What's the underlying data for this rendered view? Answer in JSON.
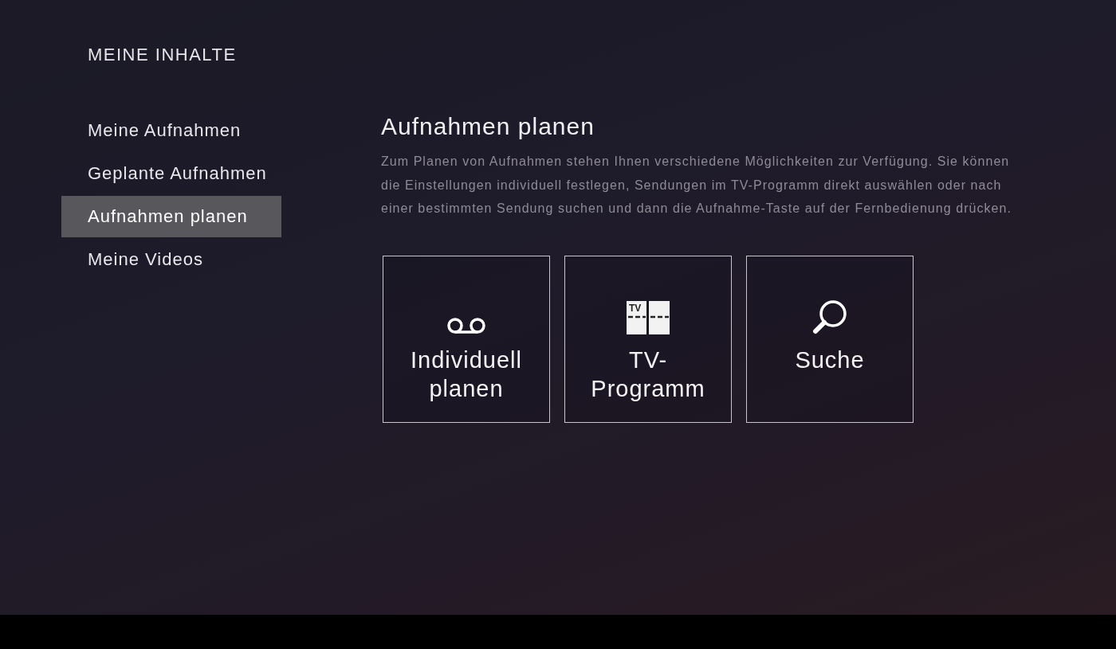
{
  "sidebar": {
    "heading": "MEINE INHALTE",
    "items": [
      {
        "label": "Meine Aufnahmen",
        "selected": false
      },
      {
        "label": "Geplante Aufnahmen",
        "selected": false
      },
      {
        "label": "Aufnahmen planen",
        "selected": true
      },
      {
        "label": "Meine Videos",
        "selected": false
      }
    ]
  },
  "content": {
    "title": "Aufnahmen planen",
    "description": "Zum Planen von Aufnahmen stehen Ihnen verschiedene Möglichkeiten zur Verfügung. Sie können die Einstellungen individuell festlegen, Sendungen im TV-Programm direkt auswählen oder nach einer bestimmten Sendung suchen und dann die Aufnahme-Taste auf der Fernbedienung drücken.",
    "tiles": [
      {
        "kind": "recording",
        "label": "Individuell planen"
      },
      {
        "kind": "guide",
        "label": "TV-Programm",
        "icon_text": "TV"
      },
      {
        "kind": "search",
        "label": "Suche"
      }
    ]
  }
}
